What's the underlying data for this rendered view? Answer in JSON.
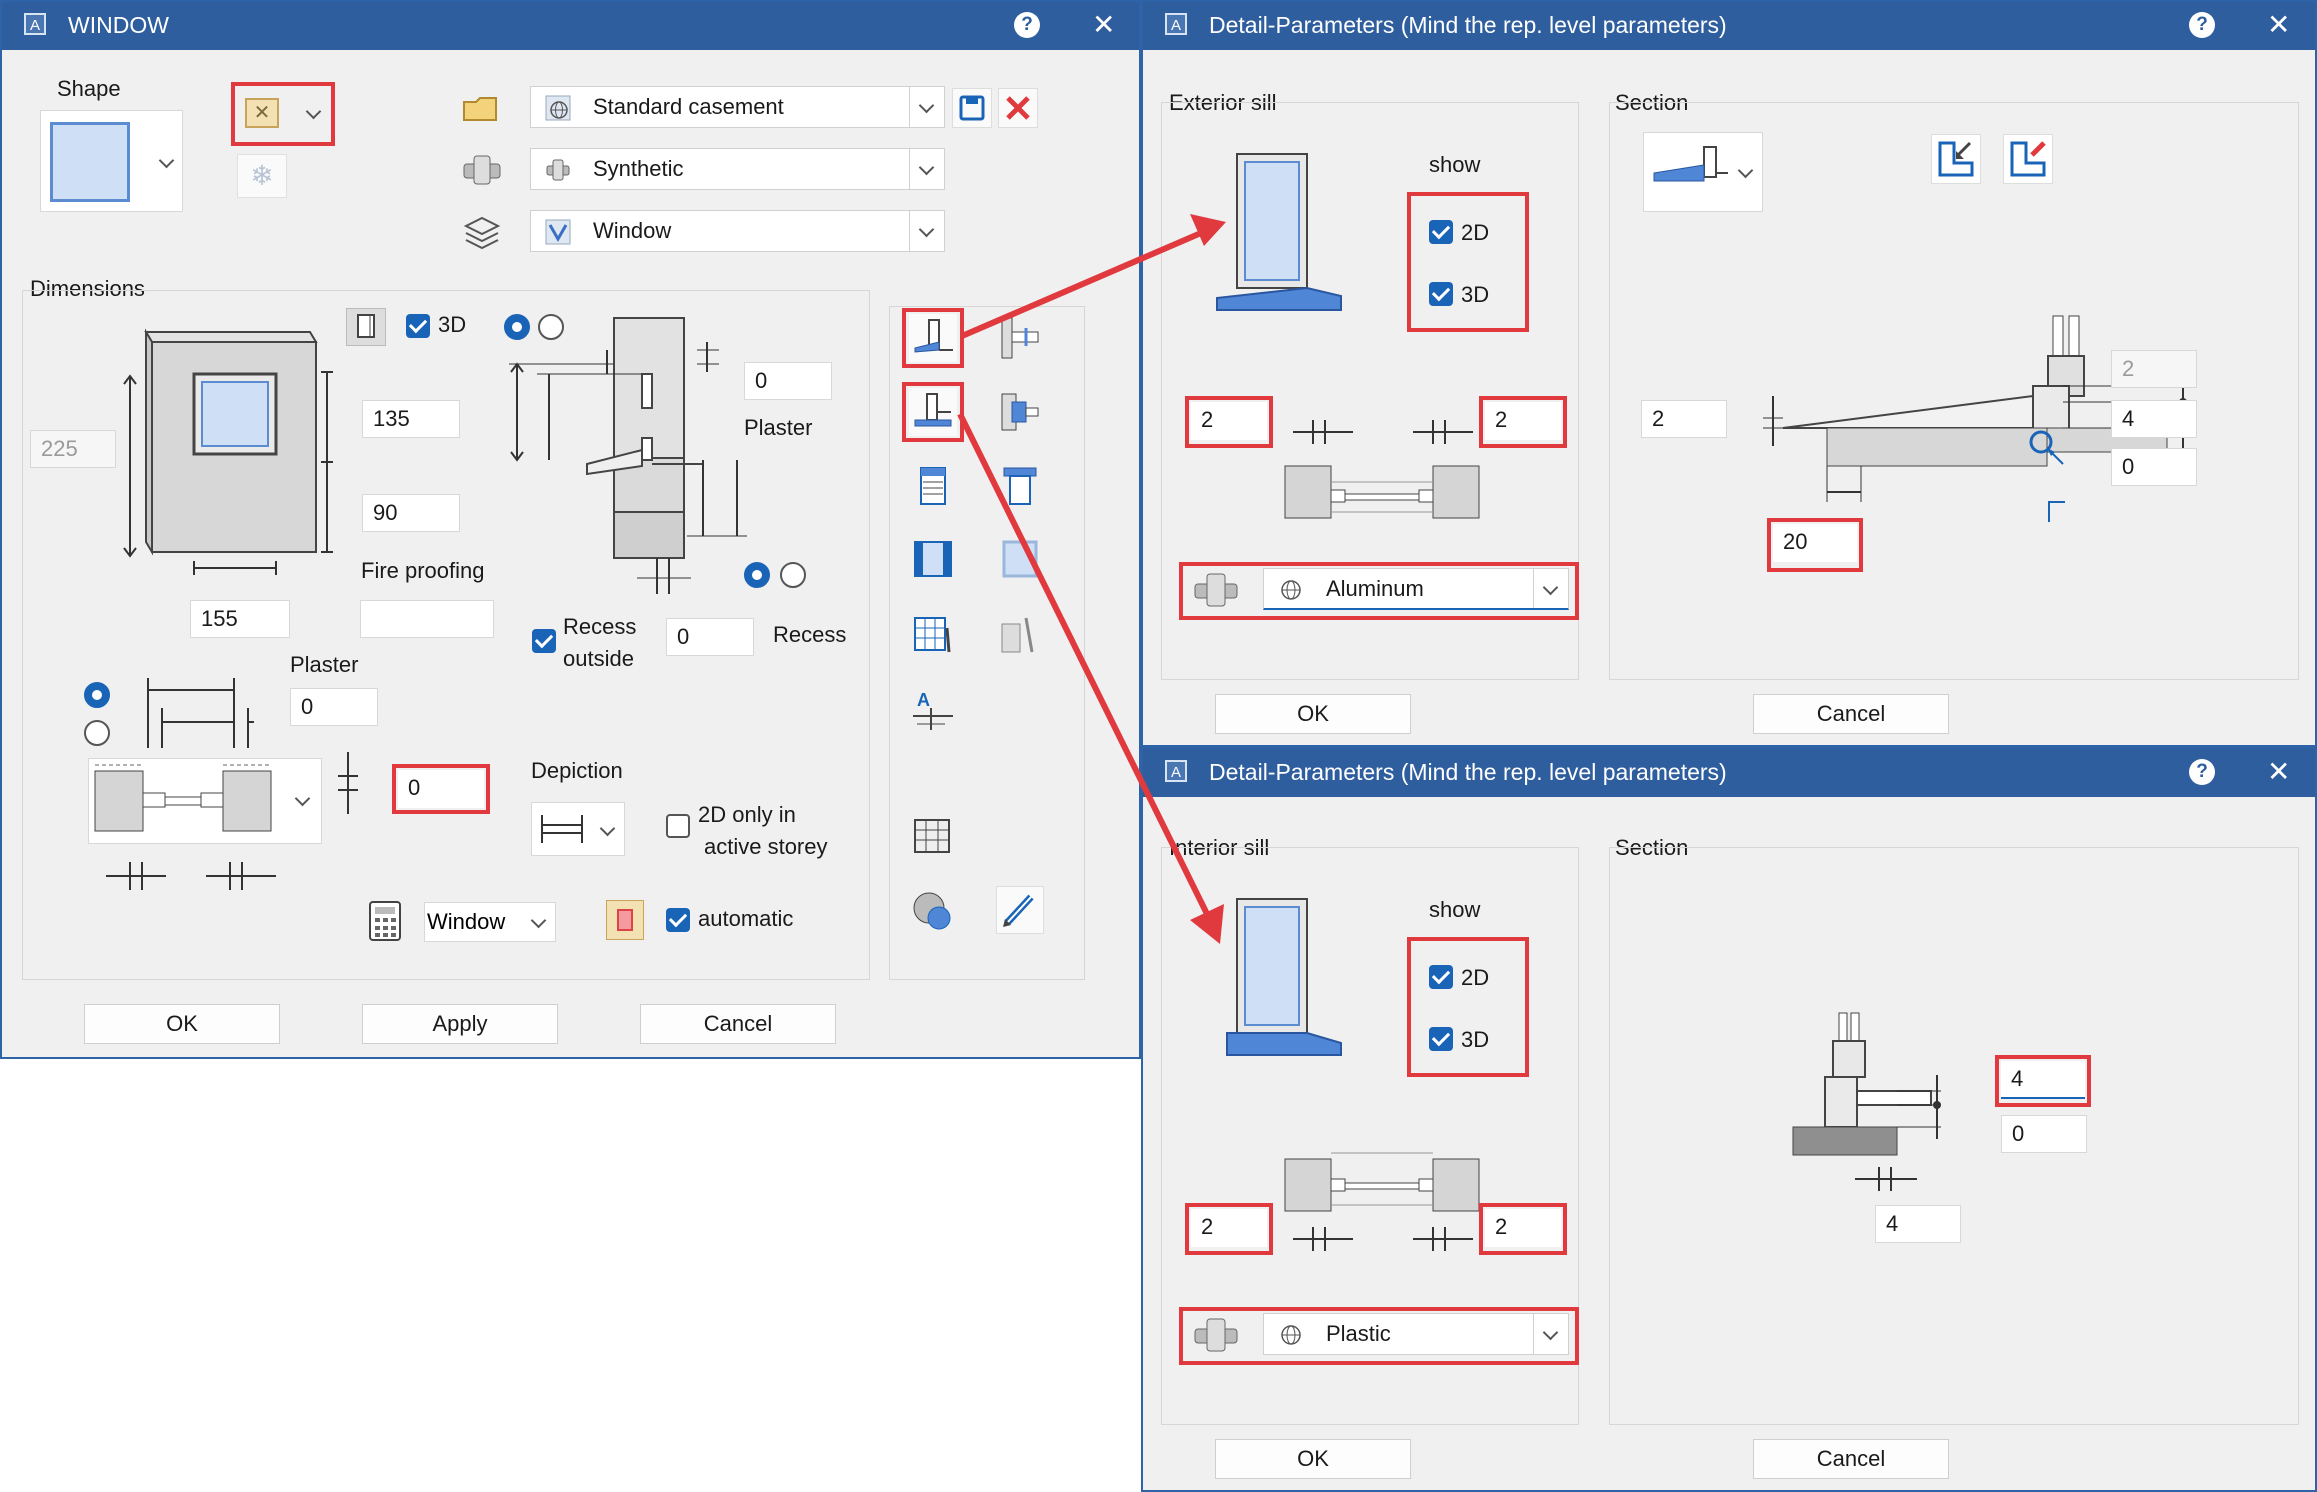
{
  "window": {
    "title": "WINDOW",
    "shape_label": "Shape",
    "profile": "Standard casement",
    "material": "Synthetic",
    "layer": "Window",
    "dimensions_label": "Dimensions",
    "check_3d": "3D",
    "width_total": "225",
    "height_upper": "135",
    "height_lower": "90",
    "width": "155",
    "fire_proofing_label": "Fire proofing",
    "plaster_top_value": "0",
    "plaster_top_label": "Plaster",
    "recess_outside_label_1": "Recess",
    "recess_outside_label_2": "outside",
    "recess_value": "0",
    "recess_label": "Recess",
    "plaster_left_label": "Plaster",
    "plaster_left_value": "0",
    "highlighted_value": "0",
    "depiction_label": "Depiction",
    "only_2d_label_1": "2D only in",
    "only_2d_label_2": "active storey",
    "window_select": "Window",
    "automatic_label": "automatic",
    "ok": "OK",
    "apply": "Apply",
    "cancel": "Cancel"
  },
  "exterior": {
    "title": "Detail-Parameters (Mind the rep. level parameters)",
    "section_left": "Exterior sill",
    "show_label": "show",
    "check_2d": "2D",
    "check_3d": "3D",
    "left_value": "2",
    "right_value": "2",
    "material": "Aluminum",
    "section_right": "Section",
    "sec_left_value": "2",
    "sec_top_value": "2",
    "sec_mid_value": "4",
    "sec_bottom_value": "0",
    "sec_depth_value": "20",
    "ok": "OK",
    "cancel": "Cancel"
  },
  "interior": {
    "title": "Detail-Parameters (Mind the rep. level parameters)",
    "section_left": "Interior sill",
    "show_label": "show",
    "check_2d": "2D",
    "check_3d": "3D",
    "left_value": "2",
    "right_value": "2",
    "material": "Plastic",
    "section_right": "Section",
    "sec_value_a": "4",
    "sec_value_b": "0",
    "sec_value_c": "4",
    "ok": "OK",
    "cancel": "Cancel"
  },
  "colors": {
    "title_bar": "#2f5e9e",
    "highlight": "#e03a3f",
    "accent": "#1a64b8",
    "glass": "#cfe0f6",
    "sill_blue": "#4f86d6"
  }
}
